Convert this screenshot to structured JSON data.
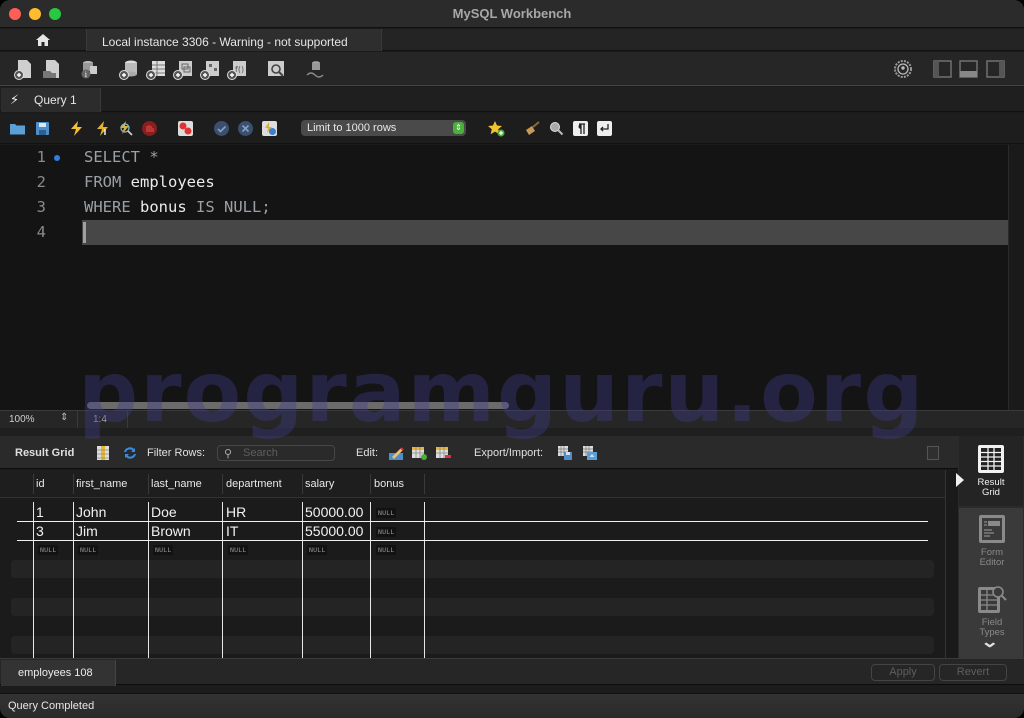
{
  "window": {
    "title": "MySQL Workbench"
  },
  "connection_tabs": {
    "home_icon": "home-icon",
    "active_tab": "Local instance 3306 - Warning - not supported"
  },
  "main_toolbar": {
    "icons": [
      "new-sql-tab-icon",
      "open-sql-script-icon",
      "schema-inspector-icon",
      "create-schema-icon",
      "create-table-icon",
      "create-view-icon",
      "create-procedure-icon",
      "create-function-icon",
      "search-table-data-icon",
      "reconnect-icon"
    ],
    "right_icons": [
      "preferences-gear-icon",
      "toggle-sidebar-icon",
      "toggle-output-icon",
      "toggle-secondary-sidebar-icon"
    ]
  },
  "query_tabs": [
    {
      "label": "Query 1",
      "icon": "lightning-icon"
    }
  ],
  "editor_toolbar": {
    "icons": [
      "open-file-icon",
      "save-icon",
      "execute-icon",
      "execute-current-icon",
      "explain-icon",
      "stop-icon",
      "toggle-error-continue-icon",
      "commit-icon",
      "rollback-icon",
      "autocommit-icon"
    ],
    "limit_select": "Limit to 1000 rows",
    "right_icons": [
      "add-snippet-icon",
      "beautify-icon",
      "find-icon",
      "invisible-chars-icon",
      "word-wrap-icon"
    ]
  },
  "editor": {
    "lines": [
      {
        "number": "1",
        "tokens": [
          {
            "t": "SELECT",
            "k": "kw"
          },
          {
            "t": " *",
            "k": "kw"
          }
        ]
      },
      {
        "number": "2",
        "tokens": [
          {
            "t": "FROM",
            "k": "kw"
          },
          {
            "t": " employees",
            "k": "id"
          }
        ]
      },
      {
        "number": "3",
        "tokens": [
          {
            "t": "WHERE",
            "k": "kw"
          },
          {
            "t": " bonus ",
            "k": "id"
          },
          {
            "t": "IS NULL;",
            "k": "kw"
          }
        ]
      },
      {
        "number": "4",
        "tokens": []
      }
    ],
    "zoom": "100%",
    "cursor_position": "1:4"
  },
  "watermark": "programguru.org",
  "results_toolbar": {
    "title": "Result Grid",
    "filter_label": "Filter Rows:",
    "search_placeholder": "Search",
    "edit_label": "Edit:",
    "export_label": "Export/Import:"
  },
  "result_grid": {
    "columns": [
      "id",
      "first_name",
      "last_name",
      "department",
      "salary",
      "bonus"
    ],
    "rows": [
      [
        "1",
        "John",
        "Doe",
        "HR",
        "50000.00",
        "NULL"
      ],
      [
        "3",
        "Jim",
        "Brown",
        "IT",
        "55000.00",
        "NULL"
      ],
      [
        "NULL",
        "NULL",
        "NULL",
        "NULL",
        "NULL",
        "NULL"
      ]
    ]
  },
  "side_panel": {
    "items": [
      {
        "label_line1": "Result",
        "label_line2": "Grid",
        "active": true
      },
      {
        "label_line1": "Form",
        "label_line2": "Editor",
        "active": false
      },
      {
        "label_line1": "Field",
        "label_line2": "Types",
        "active": false
      }
    ]
  },
  "bottom_bar": {
    "result_tab": "employees 108",
    "apply_label": "Apply",
    "revert_label": "Revert"
  },
  "status": {
    "text": "Query Completed"
  }
}
